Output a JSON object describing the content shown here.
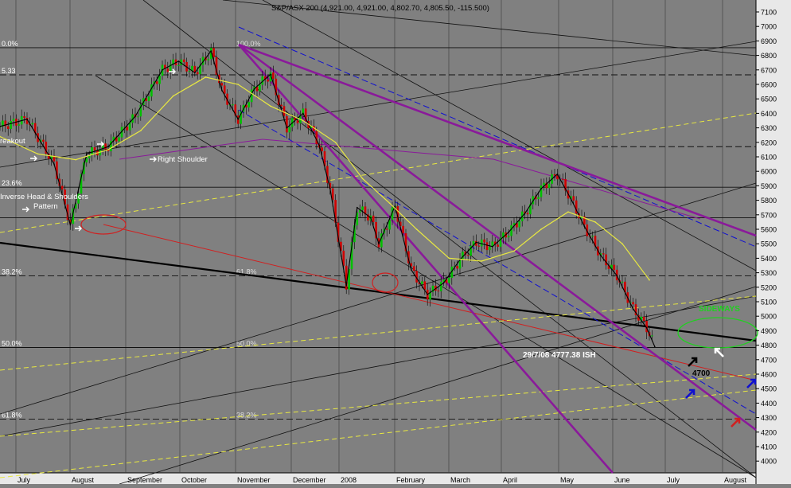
{
  "chart_data": {
    "type": "line",
    "title": "S&P/ASX 200 (4,921.00, 4,921.00, 4,802.70, 4,805.50, -115.500)",
    "xlabel": "",
    "ylabel": "",
    "ylim": [
      3900,
      7100
    ],
    "y_ticks": [
      4000,
      4100,
      4200,
      4300,
      4400,
      4500,
      4600,
      4700,
      4800,
      4900,
      5000,
      5100,
      5200,
      5300,
      5400,
      5500,
      5600,
      5700,
      5800,
      5900,
      6000,
      6100,
      6200,
      6300,
      6400,
      6500,
      6600,
      6700,
      6800,
      6900,
      7000,
      7100
    ],
    "y_tick_labels": [
      "4000",
      "4100",
      "4200",
      "4300",
      "4400",
      "4500",
      "4600",
      "4700",
      "4800",
      "4900",
      "5000",
      "5100",
      "5200",
      "5300",
      "5400",
      "5500",
      "5600",
      "5700",
      "5800",
      "5900",
      "6000",
      "6100",
      "6200",
      "6300",
      "6400",
      "6500",
      "6600",
      "6700",
      "6800",
      "6900",
      "7000",
      "7100"
    ],
    "x_categories": [
      "July",
      "August",
      "September",
      "October",
      "November",
      "December",
      "2008",
      "February",
      "March",
      "April",
      "May",
      "June",
      "July",
      "August"
    ],
    "x_month_index": [
      0,
      1,
      2,
      3,
      4,
      5,
      6,
      7,
      8,
      9,
      10,
      11,
      12,
      13
    ],
    "series": [
      {
        "name": "",
        "kind": "close",
        "month_index": [
          0,
          0.5,
          1.0,
          1.3,
          1.6,
          2.0,
          2.5,
          3.0,
          3.3,
          3.6,
          3.9,
          4.1,
          4.4,
          4.7,
          5.0,
          5.3,
          5.6,
          5.9,
          6.1,
          6.4,
          6.6,
          6.85,
          7.0,
          7.3,
          7.6,
          7.9,
          8.2,
          8.5,
          8.8,
          9.1,
          9.4,
          9.7,
          10.0,
          10.3,
          10.55,
          10.8,
          11.1,
          11.4,
          11.7,
          11.95,
          12.1
        ],
        "values": [
          6310,
          6360,
          6050,
          5630,
          6120,
          6170,
          6380,
          6700,
          6760,
          6680,
          6830,
          6560,
          6360,
          6570,
          6670,
          6300,
          6400,
          6180,
          5880,
          5210,
          5750,
          5680,
          5500,
          5760,
          5320,
          5150,
          5230,
          5390,
          5510,
          5480,
          5580,
          5710,
          5880,
          5980,
          5810,
          5620,
          5420,
          5280,
          5050,
          4920,
          4790
        ]
      },
      {
        "name": "",
        "kind": "moving-average",
        "month_index": [
          0,
          0.7,
          1.4,
          2.0,
          2.6,
          3.2,
          3.8,
          4.4,
          5.0,
          5.6,
          6.2,
          6.7,
          7.2,
          7.7,
          8.3,
          8.9,
          9.5,
          10.0,
          10.5,
          11.0,
          11.5,
          12.0
        ],
        "values": [
          6240,
          6120,
          6080,
          6150,
          6280,
          6520,
          6650,
          6600,
          6450,
          6350,
          6200,
          5950,
          5780,
          5600,
          5400,
          5380,
          5450,
          5600,
          5720,
          5650,
          5500,
          5250
        ]
      }
    ],
    "levels": [
      {
        "label": "0.0%",
        "value": 6853
      },
      {
        "label": "5.33",
        "value": 6666
      },
      {
        "label": "23.6%",
        "value": 5890
      },
      {
        "label": "38.2%",
        "value": 5279
      },
      {
        "label": "61.8%",
        "value": 5279
      },
      {
        "label": "50.0%",
        "value": 4784
      },
      {
        "label": "50.0%",
        "value": 4784
      },
      {
        "label": "61.8%",
        "value": 4290
      },
      {
        "label": "38.2%",
        "value": 4290
      },
      {
        "label": "100.0%",
        "value": 6853
      }
    ],
    "annotations": [
      "reakout",
      "Right Shoulder",
      "Inverse Head & Shoulders",
      "Pattern",
      "SIDEWAYS",
      "29/7/08 4777.38 ISH",
      "4700"
    ],
    "grid": true,
    "legend": "none"
  },
  "colors": {
    "background": "#808080",
    "price_up": "#00c000",
    "price_down": "#d00000",
    "trendline_purple": "#8a1a9a",
    "channel_blue": "#1010d0",
    "fib_yellow": "#e8e840",
    "ellipse_red": "#d02020",
    "ellipse_green": "#20d020"
  }
}
